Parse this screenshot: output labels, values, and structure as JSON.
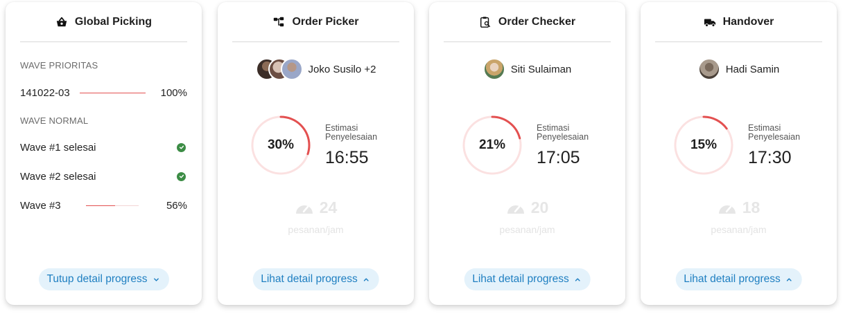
{
  "global_picking": {
    "title": "Global Picking",
    "wave_priority_label": "WAVE PRIORITAS",
    "priority_wave": {
      "name": "141022-03",
      "progress": 100,
      "pct_label": "100%"
    },
    "wave_normal_label": "WAVE NORMAL",
    "normal_waves": [
      {
        "name": "Wave #1 selesai",
        "done": true
      },
      {
        "name": "Wave #2 selesai",
        "done": true
      },
      {
        "name": "Wave #3",
        "progress": 56,
        "pct_label": "56%"
      }
    ],
    "button_label": "Tutup detail progress",
    "button_icon": "chevron-down-icon"
  },
  "cards": [
    {
      "title": "Order Picker",
      "icon": "hierarchy-icon",
      "person": "Joko Susilo +2",
      "progress": 30,
      "pct_label": "30%",
      "eta_label": "Estimasi Penyelesaian",
      "eta_time": "16:55",
      "rate": "24",
      "rate_unit": "pesanan/jam",
      "button_label": "Lihat detail progress"
    },
    {
      "title": "Order Checker",
      "icon": "clipboard-search-icon",
      "person": "Siti Sulaiman",
      "progress": 21,
      "pct_label": "21%",
      "eta_label": "Estimasi Penyelesaian",
      "eta_time": "17:05",
      "rate": "20",
      "rate_unit": "pesanan/jam",
      "button_label": "Lihat detail progress"
    },
    {
      "title": "Handover",
      "icon": "truck-icon",
      "person": "Hadi Samin",
      "progress": 15,
      "pct_label": "15%",
      "eta_label": "Estimasi Penyelesaian",
      "eta_time": "17:30",
      "rate": "18",
      "rate_unit": "pesanan/jam",
      "button_label": "Lihat detail progress"
    }
  ],
  "colors": {
    "accent_red": "#e35050",
    "ring_track": "#fbe1e1",
    "button_bg": "#e4f2fb",
    "button_text": "#1f7fc1",
    "success": "#3c8c45"
  }
}
